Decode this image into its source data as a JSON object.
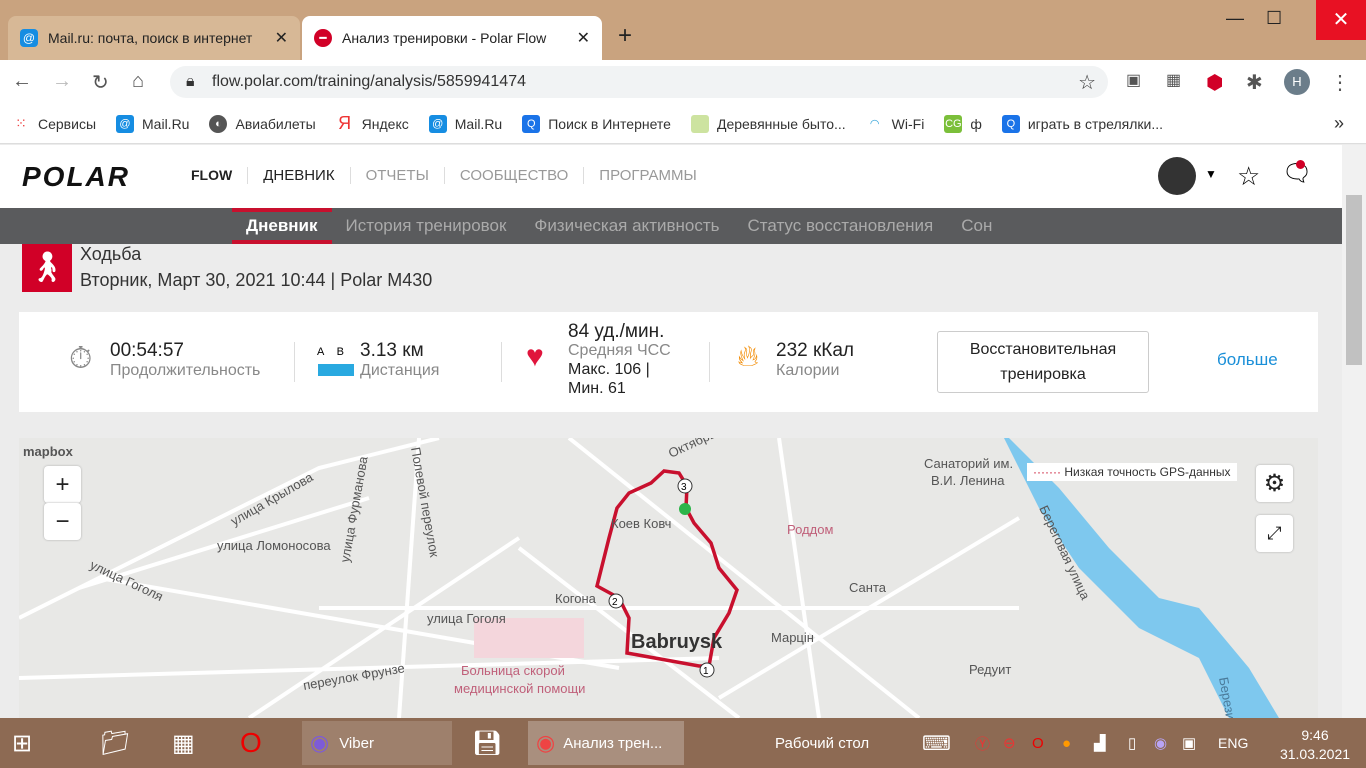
{
  "browser": {
    "tabs": [
      {
        "title": "Mail.ru: почта, поиск в интернет",
        "icon": "mailru-icon"
      },
      {
        "title": "Анализ тренировки - Polar Flow",
        "icon": "polar-icon",
        "active": true
      }
    ],
    "url": "flow.polar.com/training/analysis/5859941474",
    "profile_initial": "H",
    "bookmarks": [
      {
        "label": "Сервисы",
        "icon": "apps-icon"
      },
      {
        "label": "Mail.Ru",
        "icon": "mailru-icon"
      },
      {
        "label": "Авиабилеты",
        "icon": "globe-icon"
      },
      {
        "label": "Яндекс",
        "icon": "yandex-icon"
      },
      {
        "label": "Mail.Ru",
        "icon": "mailru-icon"
      },
      {
        "label": "Поиск в Интернете",
        "icon": "search-icon"
      },
      {
        "label": "Деревянные быто...",
        "icon": "page-icon"
      },
      {
        "label": "Wi-Fi",
        "icon": "wifi-icon"
      },
      {
        "label": "ф",
        "icon": "cg-icon"
      },
      {
        "label": "играть в стрелялки...",
        "icon": "search-icon"
      }
    ],
    "bookmarks_more": "»"
  },
  "polar": {
    "logo": "POLAR",
    "flow": "FLOW",
    "nav": [
      "ДНЕВНИК",
      "ОТЧЕТЫ",
      "СООБЩЕСТВО",
      "ПРОГРАММЫ"
    ],
    "subnav": [
      "Дневник",
      "История тренировок",
      "Физическая активность",
      "Статус восстановления",
      "Сон"
    ]
  },
  "training": {
    "sport": "Ходьба",
    "date": "Вторник, Март 30, 2021 10:44 | Polar M430",
    "duration": "00:54:57",
    "duration_label": "Продолжительность",
    "distance_a": "A",
    "distance_b": "B",
    "distance": "3.13 км",
    "distance_label": "Дистанция",
    "hr": "84 уд./мин.",
    "hr_label": "Средняя ЧСС",
    "hr_max": "Макс. 106  |",
    "hr_min": "Мин. 61",
    "calories": "232 кКал",
    "calories_label": "Калории",
    "benefit": "Восстановительная тренировка",
    "more": "больше"
  },
  "map": {
    "attribution": "mapbox",
    "gps_legend": "Низкая точность GPS-данных",
    "zoom_in": "+",
    "zoom_out": "−",
    "route_color": "#c8102e",
    "labels": [
      "улица Крылова",
      "улица Фурманова",
      "Полевой переулок",
      "улица Ломоносова",
      "улица Гоголя",
      "улица Гоголя",
      "переулок Фрунзе",
      "Больница скорой",
      "медицинской помощи",
      "Когона",
      "Babruysk",
      "Роддом",
      "Марцін",
      "Санта",
      "Санаторий им.",
      "В.И. Ленина",
      "Береговая улица",
      "Редуит",
      "Октябрьская",
      "Коев Ковч",
      "Березина"
    ],
    "markers": [
      "1",
      "2",
      "3"
    ]
  },
  "taskbar": {
    "viber": "Viber",
    "chrome": "Анализ трен...",
    "desktop": "Рабочий стол",
    "lang": "ENG",
    "time": "9:46",
    "date": "31.03.2021"
  }
}
